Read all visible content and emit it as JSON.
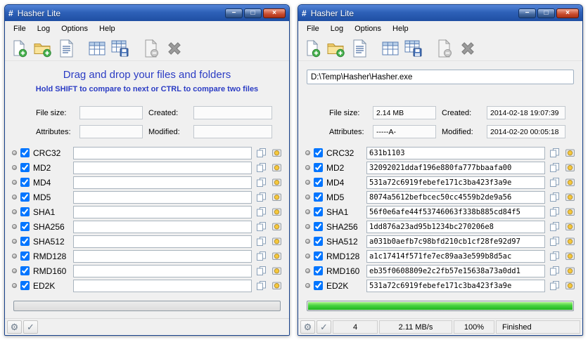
{
  "app": {
    "title": "Hasher Lite",
    "icon_glyph": "#",
    "menu": [
      "File",
      "Log",
      "Options",
      "Help"
    ],
    "toolbar_buttons": [
      "add-file",
      "add-folder",
      "report",
      "table",
      "table-save",
      "remove-file",
      "delete-all"
    ],
    "glyphs": {
      "min": "−",
      "max": "□",
      "close": "×",
      "gear": "⚙",
      "check": "✓"
    }
  },
  "labels": {
    "file_size": "File size:",
    "created": "Created:",
    "attributes": "Attributes:",
    "modified": "Modified:"
  },
  "colors": {
    "titlebar_blue": "#2e61b8",
    "drop_text_blue": "#2b3cc4",
    "progress_green": "#2ecc2e"
  },
  "left_window": {
    "drop_title": "Drag and drop your files and folders",
    "drop_subtitle": "Hold SHIFT to compare to next or CTRL to compare two files",
    "file_info": {
      "file_size": "",
      "created": "",
      "attributes": "",
      "modified": ""
    },
    "hashes": [
      {
        "name": "CRC32",
        "checked": true,
        "value": ""
      },
      {
        "name": "MD2",
        "checked": true,
        "value": ""
      },
      {
        "name": "MD4",
        "checked": true,
        "value": ""
      },
      {
        "name": "MD5",
        "checked": true,
        "value": ""
      },
      {
        "name": "SHA1",
        "checked": true,
        "value": ""
      },
      {
        "name": "SHA256",
        "checked": true,
        "value": ""
      },
      {
        "name": "SHA512",
        "checked": true,
        "value": ""
      },
      {
        "name": "RMD128",
        "checked": true,
        "value": ""
      },
      {
        "name": "RMD160",
        "checked": true,
        "value": ""
      },
      {
        "name": "ED2K",
        "checked": true,
        "value": ""
      }
    ],
    "progress_percent": 0
  },
  "right_window": {
    "path": "D:\\Temp\\Hasher\\Hasher.exe",
    "file_info": {
      "file_size": "2.14 MB",
      "created": "2014-02-18 19:07:39",
      "attributes": "-----A-",
      "modified": "2014-02-20 00:05:18"
    },
    "hashes": [
      {
        "name": "CRC32",
        "checked": true,
        "value": "631b1103"
      },
      {
        "name": "MD2",
        "checked": true,
        "value": "32092021ddaf196e880fa777bbaafa00"
      },
      {
        "name": "MD4",
        "checked": true,
        "value": "531a72c6919febefe171c3ba423f3a9e"
      },
      {
        "name": "MD5",
        "checked": true,
        "value": "8074a5612befbcec50cc4559b2de9a56"
      },
      {
        "name": "SHA1",
        "checked": true,
        "value": "56f0e6afe44f53746063f338b885cd84f5"
      },
      {
        "name": "SHA256",
        "checked": true,
        "value": "1dd876a23ad95b1234bc270206e8"
      },
      {
        "name": "SHA512",
        "checked": true,
        "value": "a031b0aefb7c98bfd210cb1cf28fe92d97"
      },
      {
        "name": "RMD128",
        "checked": true,
        "value": "a1c17414f571fe7ec89aa3e599b8d5ac"
      },
      {
        "name": "RMD160",
        "checked": true,
        "value": "eb35f0608809e2c2fb57e15638a73a0dd1"
      },
      {
        "name": "ED2K",
        "checked": true,
        "value": "531a72c6919febefe171c3ba423f3a9e"
      }
    ],
    "progress_percent": 100,
    "status": {
      "count": "4",
      "speed": "2.11 MB/s",
      "percent": "100%",
      "state": "Finished"
    }
  }
}
